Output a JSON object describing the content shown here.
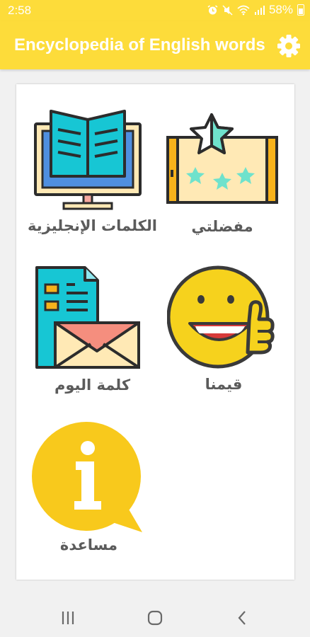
{
  "status_bar": {
    "time": "2:58",
    "icons": [
      "alarm-icon",
      "mute-icon",
      "wifi-icon",
      "signal-icon"
    ],
    "battery": "58%"
  },
  "app_bar": {
    "title": "Encyclopedia of English words",
    "background": "#fddc3a",
    "settings_icon": "gear-icon"
  },
  "menu": {
    "english_words": "الكلمات الإنجليزية",
    "favorites": "مفضلتي",
    "word_of_day": "كلمة اليوم",
    "rate_us": "قيمنا",
    "help": "مساعدة"
  },
  "nav_bar": {
    "recents_icon": "recents-icon",
    "home_icon": "home-icon",
    "back_icon": "back-icon"
  }
}
